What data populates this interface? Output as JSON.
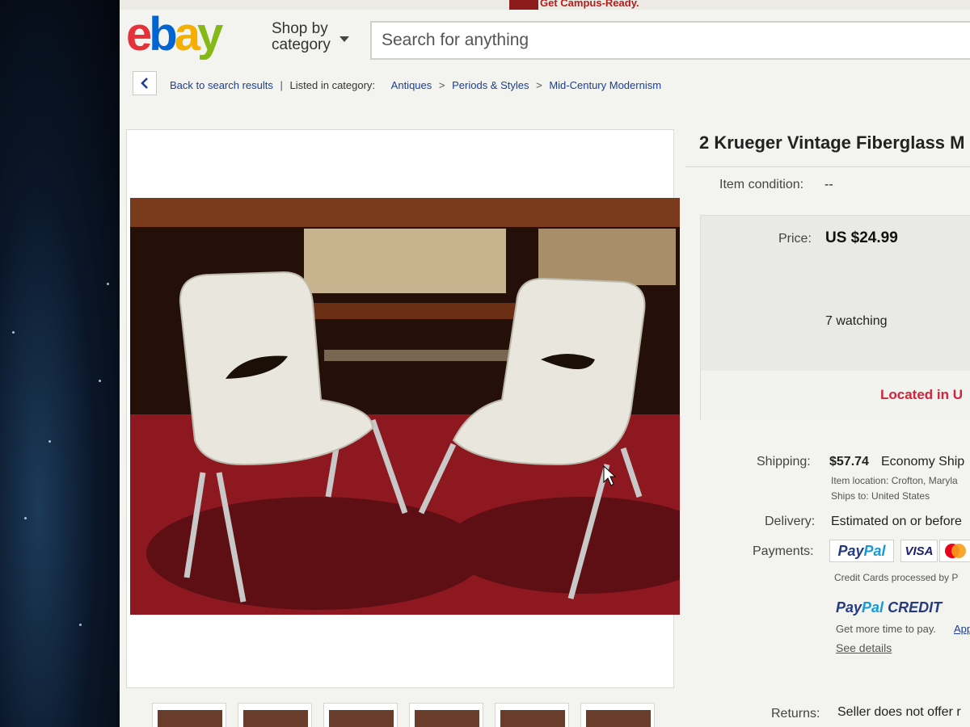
{
  "promo": {
    "text": "Get Campus-Ready."
  },
  "header": {
    "logo_letters": [
      "e",
      "b",
      "a",
      "y"
    ],
    "shop_by_line1": "Shop by",
    "shop_by_line2": "category",
    "search_placeholder": "Search for anything"
  },
  "breadcrumb": {
    "back_label": "Back to search results",
    "listed_label": "Listed in category:",
    "categories": [
      "Antiques",
      "Periods & Styles",
      "Mid-Century Modernism"
    ]
  },
  "item": {
    "title": "2 Krueger Vintage Fiberglass M",
    "condition_label": "Item condition:",
    "condition_value": "--",
    "price_label": "Price:",
    "price_value": "US $24.99",
    "watching": "7 watching",
    "located": "Located in U",
    "shipping_label": "Shipping:",
    "shipping_cost": "$57.74",
    "shipping_method": "Economy Ship",
    "item_location": "Item location:  Crofton, Maryla",
    "ships_to": "Ships to:  United States",
    "delivery_label": "Delivery:",
    "delivery_value": "Estimated on or before",
    "payments_label": "Payments:",
    "paypal_part1": "Pay",
    "paypal_part2": "Pal",
    "visa": "VISA",
    "credit_cards_note": "Credit Cards processed by P",
    "paypal_credit_word": "CREDIT",
    "more_time": "Get more time to pay.",
    "apply_link": "App",
    "see_details": "See details",
    "returns_label": "Returns:",
    "returns_value": "Seller does not offer r"
  },
  "colors": {
    "ebay_red": "#e53238",
    "ebay_blue": "#0064d2",
    "ebay_yellow": "#f5af02",
    "ebay_green": "#86b817",
    "link_blue": "#1b3f94",
    "located_red": "#d4233a"
  },
  "icons": {
    "back": "chevron-left-icon",
    "caret": "caret-down-icon",
    "mastercard": "mastercard-icon",
    "cursor": "mouse-cursor-icon"
  }
}
